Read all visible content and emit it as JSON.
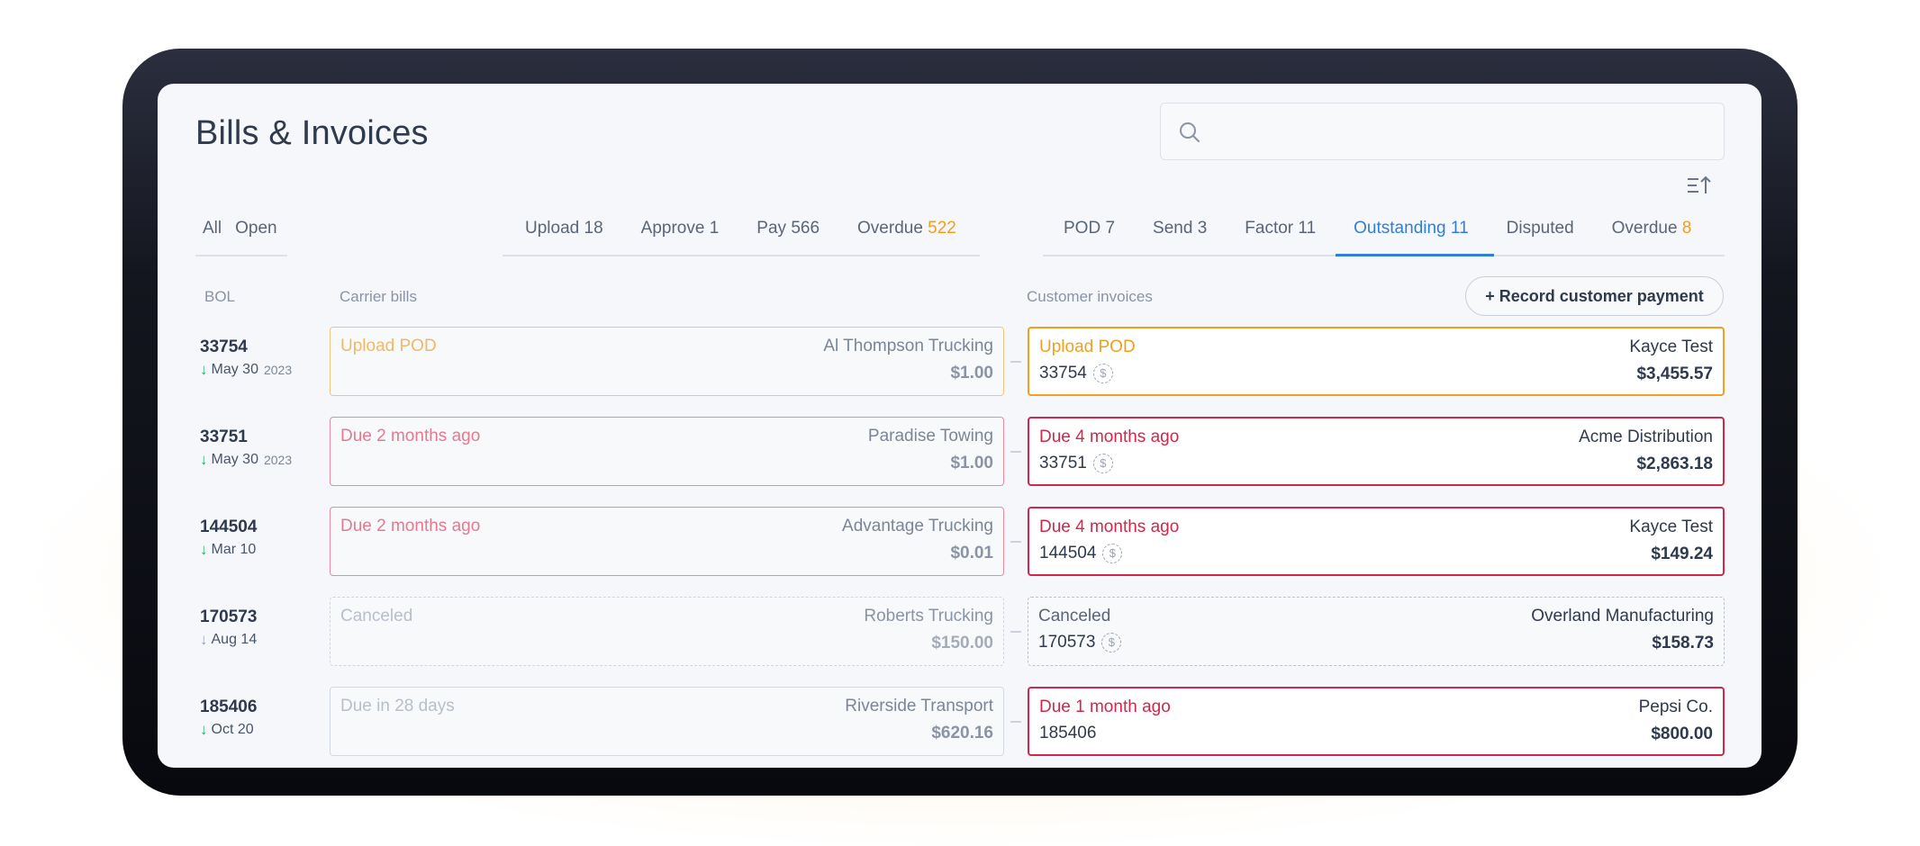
{
  "page": {
    "title": "Bills & Invoices"
  },
  "search": {
    "placeholder": ""
  },
  "tabs": {
    "left": [
      {
        "label": "All"
      },
      {
        "label": "Open"
      }
    ],
    "bills": [
      {
        "label": "Upload",
        "count": "18"
      },
      {
        "label": "Approve",
        "count": "1"
      },
      {
        "label": "Pay",
        "count": "566"
      },
      {
        "label": "Overdue",
        "count": "522"
      }
    ],
    "invoices": [
      {
        "label": "POD",
        "count": "7"
      },
      {
        "label": "Send",
        "count": "3"
      },
      {
        "label": "Factor",
        "count": "11"
      },
      {
        "label": "Outstanding",
        "count": "11",
        "active": true
      },
      {
        "label": "Disputed",
        "count": ""
      },
      {
        "label": "Overdue",
        "count": "8"
      }
    ]
  },
  "columns": {
    "bol": "BOL",
    "carrier": "Carrier bills",
    "customer": "Customer invoices"
  },
  "actions": {
    "record_payment": "+ Record customer payment"
  },
  "colors": {
    "accent": "#2f7fd8",
    "orange": "#f0a020",
    "red": "#d0284b",
    "green": "#1bb36a"
  },
  "rows": [
    {
      "bol": "33754",
      "date": "May 30",
      "year": "2023",
      "arrow": "green",
      "bill": {
        "status": "Upload POD",
        "carrier": "Al Thompson Trucking",
        "amount": "$1.00",
        "kind": "upload"
      },
      "invoice": {
        "status": "Upload POD",
        "ref": "33754",
        "customer": "Kayce Test",
        "amount": "$3,455.57",
        "kind": "upload",
        "dollar_icon": true
      }
    },
    {
      "bol": "33751",
      "date": "May 30",
      "year": "2023",
      "arrow": "green",
      "bill": {
        "status": "Due 2 months ago",
        "carrier": "Paradise Towing",
        "amount": "$1.00",
        "kind": "overdue"
      },
      "invoice": {
        "status": "Due 4 months ago",
        "ref": "33751",
        "customer": "Acme Distribution",
        "amount": "$2,863.18",
        "kind": "overdue",
        "dollar_icon": true
      }
    },
    {
      "bol": "144504",
      "date": "Mar 10",
      "year": "",
      "arrow": "green",
      "bill": {
        "status": "Due 2 months ago",
        "carrier": "Advantage Trucking",
        "amount": "$0.01",
        "kind": "overdue"
      },
      "invoice": {
        "status": "Due 4 months ago",
        "ref": "144504",
        "customer": "Kayce Test",
        "amount": "$149.24",
        "kind": "overdue",
        "dollar_icon": true
      }
    },
    {
      "bol": "170573",
      "date": "Aug 14",
      "year": "",
      "arrow": "gray",
      "bill": {
        "status": "Canceled",
        "carrier": "Roberts Trucking",
        "amount": "$150.00",
        "kind": "canceled"
      },
      "invoice": {
        "status": "Canceled",
        "ref": "170573",
        "customer": "Overland Manufacturing",
        "amount": "$158.73",
        "kind": "canceled",
        "dollar_icon": true
      }
    },
    {
      "bol": "185406",
      "date": "Oct 20",
      "year": "",
      "arrow": "green",
      "bill": {
        "status": "Due in 28 days",
        "carrier": "Riverside Transport",
        "amount": "$620.16",
        "kind": "upcoming"
      },
      "invoice": {
        "status": "Due 1 month ago",
        "ref": "185406",
        "customer": "Pepsi Co.",
        "amount": "$800.00",
        "kind": "overdue",
        "dollar_icon": false
      }
    }
  ]
}
